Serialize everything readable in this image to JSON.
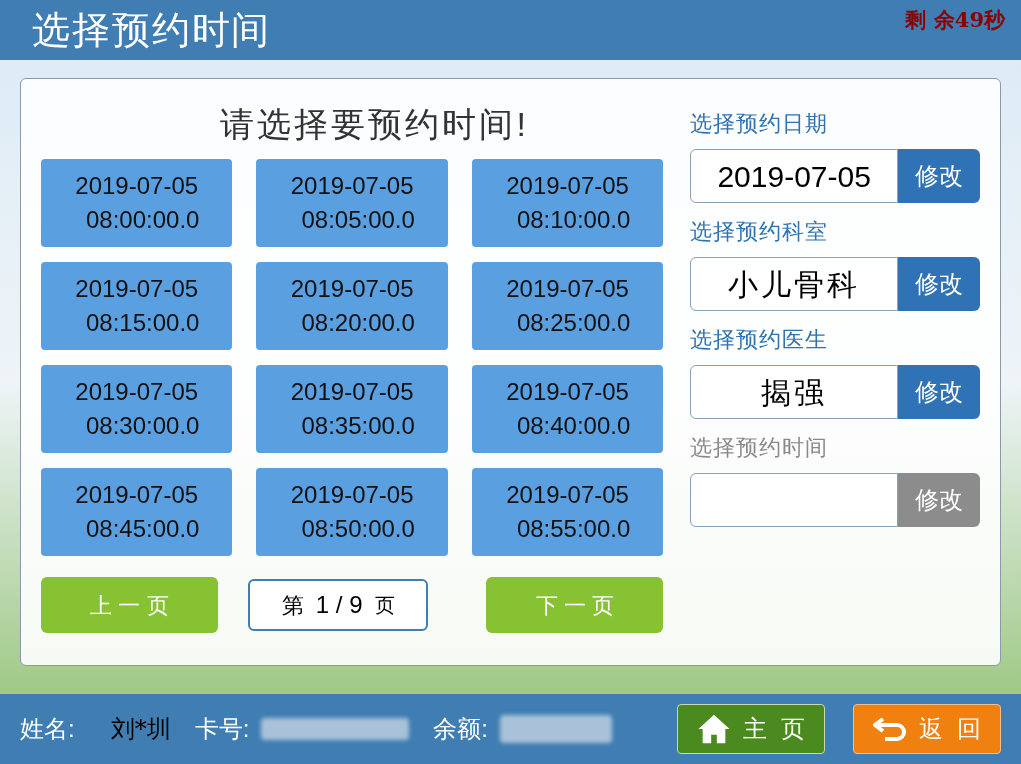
{
  "header": {
    "title": "选择预约时间",
    "countdown": "剩 余49秒"
  },
  "prompt": "请选择要预约时间!",
  "slots": [
    {
      "date": "2019-07-05",
      "time": "08:00:00.0"
    },
    {
      "date": "2019-07-05",
      "time": "08:05:00.0"
    },
    {
      "date": "2019-07-05",
      "time": "08:10:00.0"
    },
    {
      "date": "2019-07-05",
      "time": "08:15:00.0"
    },
    {
      "date": "2019-07-05",
      "time": "08:20:00.0"
    },
    {
      "date": "2019-07-05",
      "time": "08:25:00.0"
    },
    {
      "date": "2019-07-05",
      "time": "08:30:00.0"
    },
    {
      "date": "2019-07-05",
      "time": "08:35:00.0"
    },
    {
      "date": "2019-07-05",
      "time": "08:40:00.0"
    },
    {
      "date": "2019-07-05",
      "time": "08:45:00.0"
    },
    {
      "date": "2019-07-05",
      "time": "08:50:00.0"
    },
    {
      "date": "2019-07-05",
      "time": "08:55:00.0"
    }
  ],
  "pager": {
    "prev": "上 一 页",
    "page_prefix": "第",
    "page": "1 / 9",
    "page_suffix": "页",
    "next": "下 一 页"
  },
  "fields": [
    {
      "label": "选择预约日期",
      "value": "2019-07-05",
      "button": "修改",
      "disabled": false
    },
    {
      "label": "选择预约科室",
      "value": "小儿骨科",
      "button": "修改",
      "disabled": false
    },
    {
      "label": "选择预约医生",
      "value": "揭强",
      "button": "修改",
      "disabled": false
    },
    {
      "label": "选择预约时间",
      "button": "修改",
      "disabled": true
    }
  ],
  "footer": {
    "name_label": "姓名:",
    "name": "刘*圳",
    "card_label": "卡号:",
    "balance_label": "余额:",
    "home": "主  页",
    "back": "返  回"
  }
}
